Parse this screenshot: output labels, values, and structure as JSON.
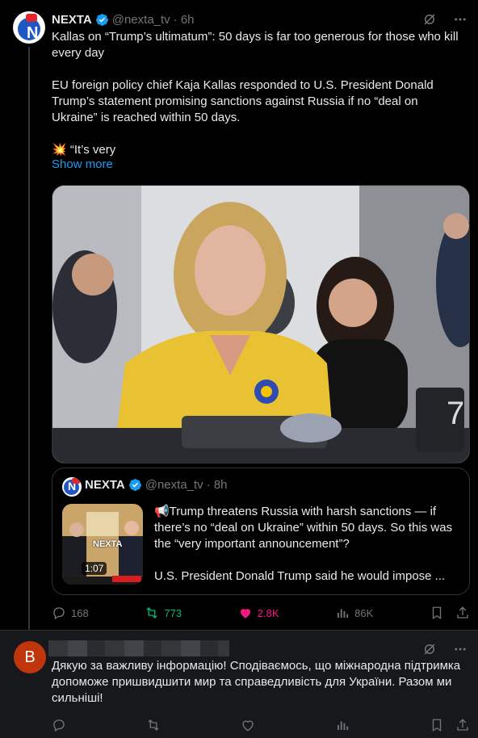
{
  "post": {
    "author": "NEXTA",
    "handle": "@nexta_tv",
    "time": "· 6h",
    "paragraphs": [
      "Kallas on “Trump’s ultimatum”: 50 days is far too generous for those who kill every day",
      "EU foreign policy chief Kaja Kallas responded to U.S. President Donald Trump’s statement promising sanctions against Russia if no “deal on Ukraine” is reached within 50 days.",
      "💥 “It’s very"
    ],
    "show_more": "Show more",
    "media_icon": "news-photo"
  },
  "quote": {
    "author": "NEXTA",
    "handle": "@nexta_tv",
    "time": "· 8h",
    "thumb_duration": "1:07",
    "thumb_overlay_text": "NEXTA",
    "paragraphs": [
      "📢Trump threatens Russia with harsh sanctions — if there’s no “deal on Ukraine” within 50 days. So this was the “very important announcement”?",
      "U.S. President Donald Trump said he would impose ..."
    ]
  },
  "engagement": {
    "replies": "168",
    "reposts": "773",
    "likes": "2.8K",
    "views": "86K"
  },
  "reply": {
    "avatar_letter": "B",
    "text": "Дякую за важливу інформацію! Сподіваємось, що міжнародна підтримка допоможе пришвидшити мир та справедливість для України. Разом ми сильніші!"
  },
  "colors": {
    "background": "#000000",
    "reply_background": "#16181c",
    "accent": "#1d9bf0",
    "repost_green": "#00ba7c",
    "like_pink": "#f91880",
    "muted": "#71767b"
  }
}
